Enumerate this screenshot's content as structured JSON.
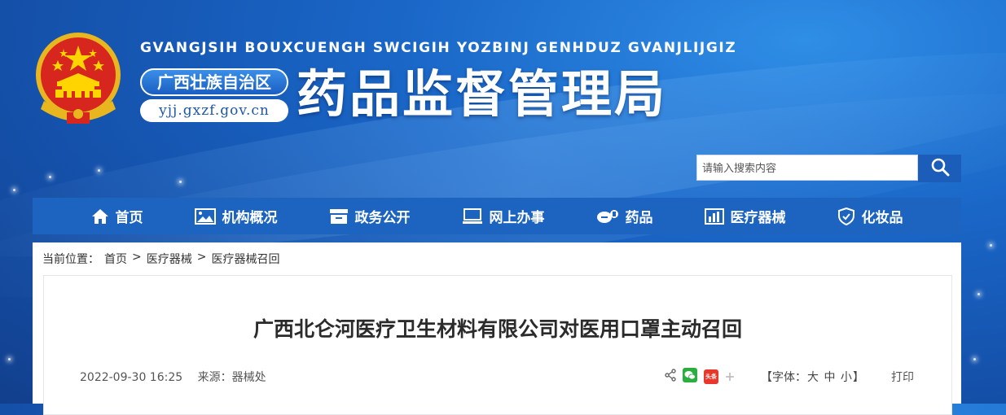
{
  "header": {
    "title_pinyin": "GVANGJSIH BOUXCUENGH SWCIGIH YOZBINJ GENHDUZ GVANJLIJGIZ",
    "region_badge": "广西壮族自治区",
    "domain": "yjj.gxzf.gov.cn",
    "title_cn": "药品监督管理局"
  },
  "search": {
    "placeholder": "请输入搜索内容",
    "icon": "search-icon"
  },
  "nav": [
    {
      "label": "首页",
      "icon": "home-icon"
    },
    {
      "label": "机构概况",
      "icon": "image-icon"
    },
    {
      "label": "政务公开",
      "icon": "archive-icon"
    },
    {
      "label": "网上办事",
      "icon": "computer-icon"
    },
    {
      "label": "药品",
      "icon": "pill-icon"
    },
    {
      "label": "医疗器械",
      "icon": "bar-chart-icon"
    },
    {
      "label": "化妆品",
      "icon": "shield-icon"
    }
  ],
  "breadcrumb": {
    "prefix": "当前位置：",
    "items": [
      "首页",
      "医疗器械",
      "医疗器械召回"
    ],
    "separator": ">"
  },
  "article": {
    "title": "广西北仑河医疗卫生材料有限公司对医用口罩主动召回",
    "datetime": "2022-09-30 16:25",
    "source": "来源：器械处",
    "font_size_label": "【字体：",
    "font_sizes": [
      "大",
      "中",
      "小"
    ],
    "font_size_close": "】",
    "print": "打印",
    "toutiao_label": "头条"
  },
  "colors": {
    "nav_bg": "#1d64c0",
    "search_button": "#1b5db8",
    "wechat": "#2aae3d",
    "toutiao": "#e8372b"
  }
}
